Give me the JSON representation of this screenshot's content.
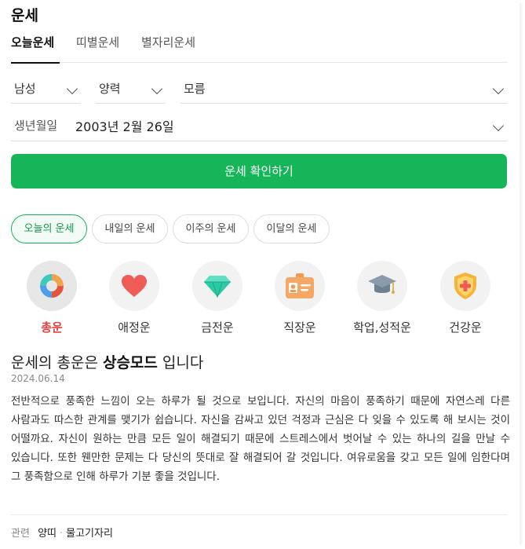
{
  "header": {
    "title": "운세"
  },
  "tabs": [
    {
      "label": "오늘운세",
      "active": true
    },
    {
      "label": "띠별운세",
      "active": false
    },
    {
      "label": "별자리운세",
      "active": false
    }
  ],
  "form": {
    "gender": "남성",
    "calendar": "양력",
    "birth_time": "모름",
    "birth_caption": "생년월일",
    "birth_value": "2003년 2월 26일",
    "submit_label": "운세 확인하기"
  },
  "period_chips": [
    {
      "label": "오늘의 운세",
      "active": true
    },
    {
      "label": "내일의 운세",
      "active": false
    },
    {
      "label": "이주의 운세",
      "active": false
    },
    {
      "label": "이달의 운세",
      "active": false
    }
  ],
  "categories": [
    {
      "label": "총운",
      "icon": "donut-chart-icon",
      "active": true
    },
    {
      "label": "애정운",
      "icon": "heart-icon",
      "active": false
    },
    {
      "label": "금전운",
      "icon": "diamond-icon",
      "active": false
    },
    {
      "label": "직장운",
      "icon": "id-badge-icon",
      "active": false
    },
    {
      "label": "학업,성적운",
      "icon": "graduation-cap-icon",
      "active": false
    },
    {
      "label": "건강운",
      "icon": "health-shield-icon",
      "active": false
    }
  ],
  "result": {
    "headline_prefix": "운세의 총운은 ",
    "headline_strong": "상승모드",
    "headline_suffix": " 입니다",
    "date": "2024.06.14",
    "text": "전반적으로 풍족한 느낌이 오는 하루가 될 것으로 보입니다. 자신의 마음이 풍족하기 때문에 자연스레 다른 사람과도 따스한 관계를 맺기가 쉽습니다. 자신을 감싸고 있던 걱정과 근심은 다 잊을 수 있도록 해 보시는 것이 어떨까요. 자신이 원하는 만큼 모든 일이 해결되기 때문에 스트레스에서 벗어날 수 있는 하나의 길을 만날 수 있습니다. 또한 웬만한 문제는 다 당신의 뜻대로 잘 해결되어 갈 것입니다. 여유로움을 갖고 모든 일에 임한다며 그 풍족함으로 인해 하루가 기분 좋을 것입니다."
  },
  "related": {
    "caption": "관련",
    "tags": [
      "양띠",
      "물고기자리"
    ]
  },
  "colors": {
    "accent": "#16b55a",
    "active_category": "#e5403f"
  }
}
